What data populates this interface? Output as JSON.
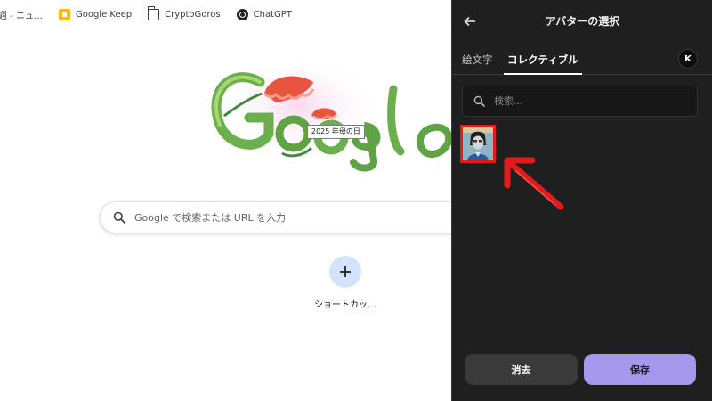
{
  "bookmarks": [
    {
      "label": "週 - ニュ…",
      "icon": "partial-icon"
    },
    {
      "label": "Google Keep",
      "icon": "google-keep-icon"
    },
    {
      "label": "CryptoGoros",
      "icon": "folder-icon"
    },
    {
      "label": "ChatGPT",
      "icon": "chatgpt-icon"
    }
  ],
  "doodle": {
    "tooltip": "2025 年母の日"
  },
  "search": {
    "placeholder": "Google で検索または URL を入力",
    "icon": "search-icon"
  },
  "shortcut": {
    "add_symbol": "+",
    "label": "ショートカッ…"
  },
  "panel": {
    "title": "アバターの選択",
    "back_icon": "arrow-left-icon",
    "tabs": [
      {
        "label": "絵文字",
        "active": false
      },
      {
        "label": "コレクティブル",
        "active": true
      }
    ],
    "user_initial": "K",
    "search_placeholder": "検索...",
    "clear_label": "消去",
    "save_label": "保存"
  },
  "colors": {
    "panel_bg": "#1f1f1f",
    "save_button": "#a597ec",
    "clear_button": "#3a3a3a",
    "highlight_red": "#e01b1b"
  }
}
